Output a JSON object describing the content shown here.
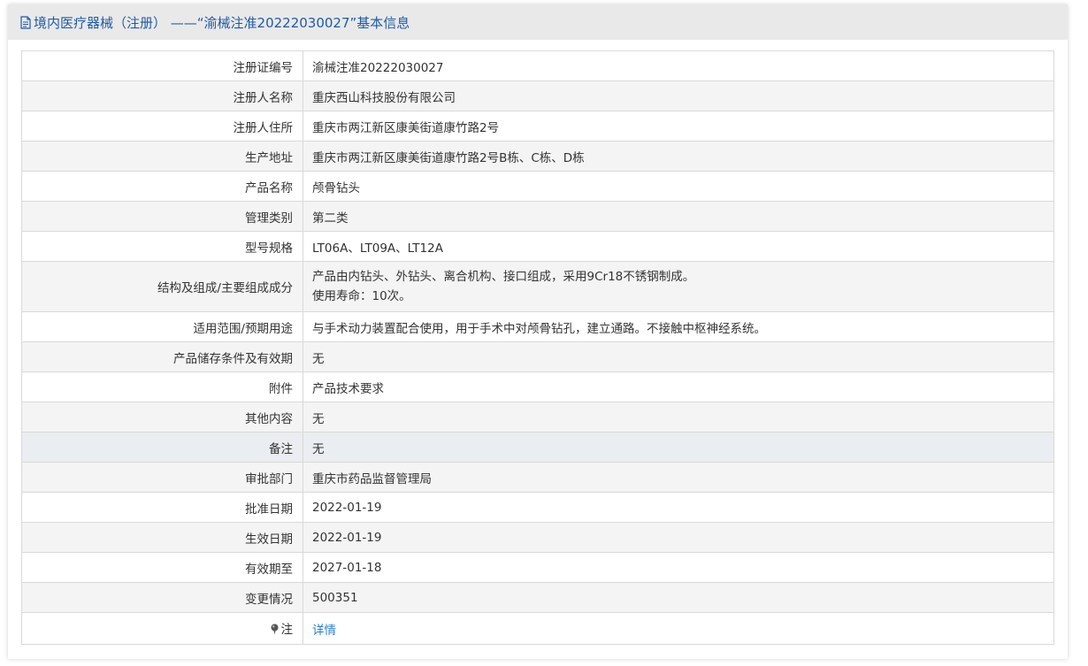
{
  "header": {
    "title": "境内医疗器械（注册）  ——“渝械注准20222030027”基本信息",
    "icon": "document-icon"
  },
  "rows": [
    {
      "label": "注册证编号",
      "value": "渝械注准20222030027"
    },
    {
      "label": "注册人名称",
      "value": "重庆西山科技股份有限公司"
    },
    {
      "label": "注册人住所",
      "value": "重庆市两江新区康美街道康竹路2号"
    },
    {
      "label": "生产地址",
      "value": "重庆市两江新区康美街道康竹路2号B栋、C栋、D栋"
    },
    {
      "label": "产品名称",
      "value": "颅骨钻头"
    },
    {
      "label": "管理类别",
      "value": "第二类"
    },
    {
      "label": "型号规格",
      "value": "LT06A、LT09A、LT12A"
    },
    {
      "label": "结构及组成/主要组成成分",
      "value_lines": [
        "产品由内钻头、外钻头、离合机构、接口组成，采用9Cr18不锈钢制成。",
        "使用寿命：10次。"
      ]
    },
    {
      "label": "适用范围/预期用途",
      "value": "与手术动力装置配合使用，用于手术中对颅骨钻孔，建立通路。不接触中枢神经系统。"
    },
    {
      "label": "产品储存条件及有效期",
      "value": "无"
    },
    {
      "label": "附件",
      "value": "产品技术要求"
    },
    {
      "label": "其他内容",
      "value": "无"
    },
    {
      "label": "备注",
      "value": "无"
    },
    {
      "label": "审批部门",
      "value": "重庆市药品监督管理局"
    },
    {
      "label": "批准日期",
      "value": "2022-01-19"
    },
    {
      "label": "生效日期",
      "value": "2022-01-19"
    },
    {
      "label": "有效期至",
      "value": "2027-01-18"
    },
    {
      "label": "变更情况",
      "value": "500351"
    }
  ],
  "note": {
    "label": "注",
    "link": "详情",
    "icon": "pin-icon"
  },
  "colors": {
    "header_text": "#1f5ba8",
    "link": "#2a7dd1",
    "stripe": "#f4f4f4"
  }
}
